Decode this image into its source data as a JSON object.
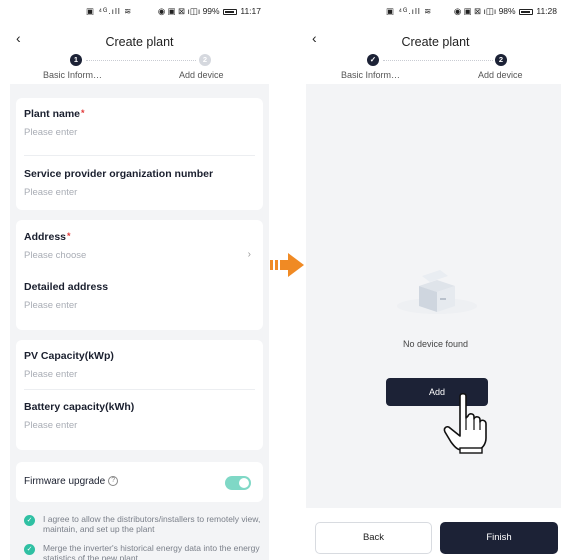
{
  "left_screen": {
    "statusbar": {
      "left_icons": "▣ ⁴ᴳ.ıll ≋",
      "right": "◉ ▣ ⊠ ı◫ı 99%",
      "time": "11:17"
    },
    "nav": {
      "back_icon": "‹",
      "title": "Create plant"
    },
    "stepper": {
      "step1_number": "1",
      "step1_label": "Basic Inform…",
      "step2_number": "2",
      "step2_label": "Add device"
    },
    "card1": {
      "plant_name_label": "Plant name",
      "plant_name_placeholder": "Please enter",
      "provider_label": "Service provider organization number",
      "provider_placeholder": "Please enter"
    },
    "card2": {
      "address_label": "Address",
      "address_placeholder": "Please choose",
      "detailed_label": "Detailed address",
      "detailed_placeholder": "Please enter"
    },
    "card3": {
      "pv_label": "PV Capacity(kWp)",
      "pv_placeholder": "Please enter",
      "battery_label": "Battery capacity(kWh)",
      "battery_placeholder": "Please enter"
    },
    "card4": {
      "firmware_label": "Firmware upgrade",
      "firmware_enabled": true
    },
    "required_mark": "*",
    "agreements": [
      "I agree to allow the distributors/installers to remotely view, maintain, and set up the plant",
      "Merge the inverter's historical energy data into the energy statistics of the new plant"
    ]
  },
  "right_screen": {
    "statusbar": {
      "left_icons": "▣ ⁴ᴳ.ıll ≋",
      "right": "◉ ▣ ⊠ ı◫ı 98%",
      "time": "11:28"
    },
    "nav": {
      "back_icon": "‹",
      "title": "Create plant"
    },
    "stepper": {
      "step1_check": "✓",
      "step1_label": "Basic Inform…",
      "step2_number": "2",
      "step2_label": "Add device"
    },
    "empty_text": "No device found",
    "add_button": "Add",
    "back_button": "Back",
    "finish_button": "Finish"
  },
  "colors": {
    "primary": "#1c2236",
    "toggle_on": "#7fd8c6",
    "check_green": "#2fc0a3",
    "arrow_orange": "#f08a24",
    "required_red": "#e23a3a"
  }
}
